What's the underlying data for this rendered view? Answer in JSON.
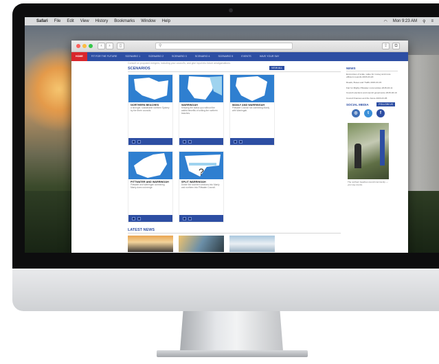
{
  "macos": {
    "apple": "",
    "menu": [
      "Safari",
      "File",
      "Edit",
      "View",
      "History",
      "Bookmarks",
      "Window",
      "Help"
    ],
    "clock": "Mon 9:23 AM"
  },
  "browser": {
    "back": "‹",
    "forward": "›"
  },
  "site": {
    "nav": [
      "HOME",
      "FIT FOR THE FUTURE",
      "SCENARIO 1",
      "SCENARIO 2",
      "SCENARIO 3",
      "SCENARIO 4",
      "SCENARIO 5",
      "EVENTS",
      "HAVE YOUR SAY"
    ],
    "tagline": "Consult on proposed mergers, including your council's, and give input into future amalgamations.",
    "scenarios_title": "SCENARIOS",
    "view_all": "VIEW ALL",
    "cards": [
      {
        "title": "NORTHERN BEACHES",
        "desc": "A stronger, sustainable northern Sydney by the three councils."
      },
      {
        "title": "WARRINGAH",
        "desc": "Keeping the status quo without the added benefits of uniting the northern beaches."
      },
      {
        "title": "MANLY AND WARRINGAH",
        "desc": "Pittwater Council not combining Manly with Warringah."
      },
      {
        "title": "PITTWATER AND WARRINGAH",
        "desc": "Pittwater and Warringah combining. Manly does not merge."
      },
      {
        "title": "SPLIT WARRINGAH",
        "desc": "Divide the southern sections into Manly and northern into Pittwater Council."
      }
    ],
    "news_title": "LATEST NEWS"
  },
  "sidebar": {
    "news_title": "NEWS",
    "links": [
      "Economies of scale, value for money and more efficient councils 2015-03-20",
      "Roads, Buses and Traffic 2015-03-15",
      "Fair for Mighty Pittwater communities 2015-03-11",
      "Council elections and council governance 2015-03-10",
      "Council finances and the future 2015-03-05"
    ],
    "social_title": "SOCIAL MEDIA",
    "follow": "FOLLOW US",
    "caption": "The northern beaches council community — your say counts."
  },
  "colors": {
    "nav": "#2d4ea3",
    "home": "#d9262c",
    "map": "#2f7fd0"
  }
}
